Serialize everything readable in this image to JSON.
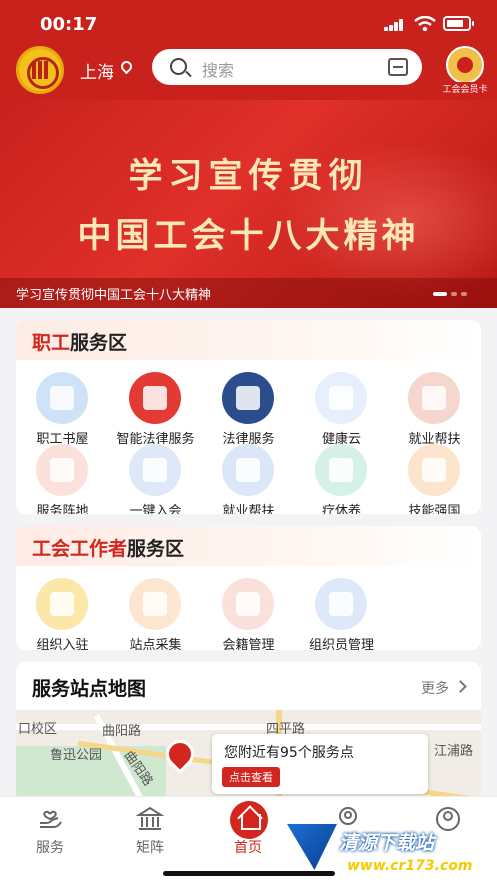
{
  "status_bar": {
    "time": "00:17"
  },
  "header": {
    "city": "上海",
    "search_placeholder": "搜索",
    "member_card_label": "工会会员卡"
  },
  "banner": {
    "line1": "学习宣传贯彻",
    "line2": "中国工会十八大精神",
    "caption": "学习宣传贯彻中国工会十八大精神",
    "page_count": 3,
    "active_page": 1
  },
  "worker_zone": {
    "title_highlight": "职工",
    "title_rest": "服务区",
    "items": [
      {
        "label": "职工书屋",
        "icon": "book-icon",
        "color": "#cfe3f8"
      },
      {
        "label": "智能法律服务",
        "icon": "ai-law-icon",
        "color": "#e33a33"
      },
      {
        "label": "法律服务",
        "icon": "12351-hotline-icon",
        "color": "#2b4d8e"
      },
      {
        "label": "健康云",
        "icon": "cloud-plus-icon",
        "color": "#e7effc"
      },
      {
        "label": "就业帮扶",
        "icon": "job-profile-icon",
        "color": "#f6d7cf"
      },
      {
        "label": "服务阵地",
        "icon": "map-location-icon",
        "color": "#fbe1dc"
      },
      {
        "label": "一键入会",
        "icon": "join-user-icon",
        "color": "#dfe8f9"
      },
      {
        "label": "就业帮扶",
        "icon": "job-star-icon",
        "color": "#dbe6f8"
      },
      {
        "label": "疗休养",
        "icon": "palm-tree-icon",
        "color": "#d6f1e9"
      },
      {
        "label": "技能强国",
        "icon": "whistle-icon",
        "color": "#fde4cc"
      }
    ]
  },
  "staff_zone": {
    "title_highlight": "工会工作者",
    "title_rest": "服务区",
    "items": [
      {
        "label": "组织入驻",
        "icon": "org-building-icon",
        "color": "#fbe7a8"
      },
      {
        "label": "站点采集",
        "icon": "site-collect-icon",
        "color": "#fde6cf"
      },
      {
        "label": "会籍管理",
        "icon": "membership-icon",
        "color": "#fbe1dc"
      },
      {
        "label": "组织员管理",
        "icon": "organizer-icon",
        "color": "#dde8f9"
      }
    ]
  },
  "map_card": {
    "title": "服务站点地图",
    "more_label": "更多",
    "labels": [
      "口校区",
      "曲阳路",
      "四平路",
      "鲁迅公园",
      "曲阳路",
      "江浦路",
      "路",
      "区"
    ],
    "popup_text": "您附近有95个服务点",
    "popup_button": "点击查看"
  },
  "tabbar": {
    "tabs": [
      {
        "label": "服务",
        "icon": "service-hand-icon",
        "active": false
      },
      {
        "label": "矩阵",
        "icon": "matrix-building-icon",
        "active": false
      },
      {
        "label": "首页",
        "icon": "home-icon",
        "active": true
      },
      {
        "label": "",
        "icon": "location-user-icon",
        "active": false
      },
      {
        "label": "",
        "icon": "profile-icon",
        "active": false
      }
    ]
  },
  "watermark": {
    "line1": "清源下载站",
    "line2": "www.cr173.com"
  },
  "colors": {
    "brand_red": "#c9211c",
    "accent_red": "#d2261f"
  }
}
